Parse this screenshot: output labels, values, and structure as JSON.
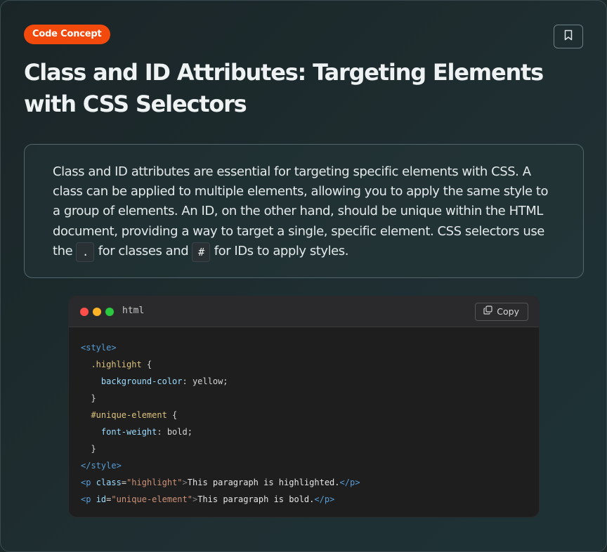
{
  "badge": {
    "label": "Code Concept"
  },
  "title": "Class and ID Attributes: Targeting Elements with CSS Selectors",
  "description": {
    "part1": "Class and ID attributes are essential for targeting specific elements with CSS. A class can be applied to multiple elements, allowing you to apply the same style to a group of elements. An ID, on the other hand, should be unique within the HTML document, providing a way to target a single, specific element. CSS selectors use the ",
    "code1": ".",
    "part2": " for classes and ",
    "code2": "#",
    "part3": " for IDs to apply styles."
  },
  "code_block": {
    "language": "html",
    "copy_label": "Copy",
    "lines": [
      [
        {
          "t": "<style>",
          "c": "tag"
        }
      ],
      [
        {
          "t": "  .highlight",
          "c": "sel"
        },
        {
          "t": " {",
          "c": "punc"
        }
      ],
      [
        {
          "t": "    background-color",
          "c": "prop"
        },
        {
          "t": ": yellow;",
          "c": "punc"
        }
      ],
      [
        {
          "t": "  }",
          "c": "punc"
        }
      ],
      [
        {
          "t": "  #unique-element",
          "c": "sel"
        },
        {
          "t": " {",
          "c": "punc"
        }
      ],
      [
        {
          "t": "    font-weight",
          "c": "prop"
        },
        {
          "t": ": bold;",
          "c": "punc"
        }
      ],
      [
        {
          "t": "  }",
          "c": "punc"
        }
      ],
      [
        {
          "t": "</style>",
          "c": "tag"
        }
      ],
      [
        {
          "t": "<p ",
          "c": "tag"
        },
        {
          "t": "class",
          "c": "attr"
        },
        {
          "t": "=",
          "c": "punc"
        },
        {
          "t": "\"highlight\"",
          "c": "str"
        },
        {
          "t": ">",
          "c": "br"
        },
        {
          "t": "This paragraph is highlighted.",
          "c": "text"
        },
        {
          "t": "</p>",
          "c": "tag"
        }
      ],
      [
        {
          "t": "<p ",
          "c": "tag"
        },
        {
          "t": "id",
          "c": "attr"
        },
        {
          "t": "=",
          "c": "punc"
        },
        {
          "t": "\"unique-element\"",
          "c": "str"
        },
        {
          "t": ">",
          "c": "br"
        },
        {
          "t": "This paragraph is bold.",
          "c": "text"
        },
        {
          "t": "</p>",
          "c": "tag"
        }
      ]
    ]
  },
  "icons": {
    "bookmark": "bookmark-icon",
    "copy": "copy-icon"
  },
  "colors": {
    "badge": "#f24a0c",
    "dot_red": "#ff4f4a",
    "dot_yellow": "#ffb428",
    "dot_green": "#2bc940"
  }
}
